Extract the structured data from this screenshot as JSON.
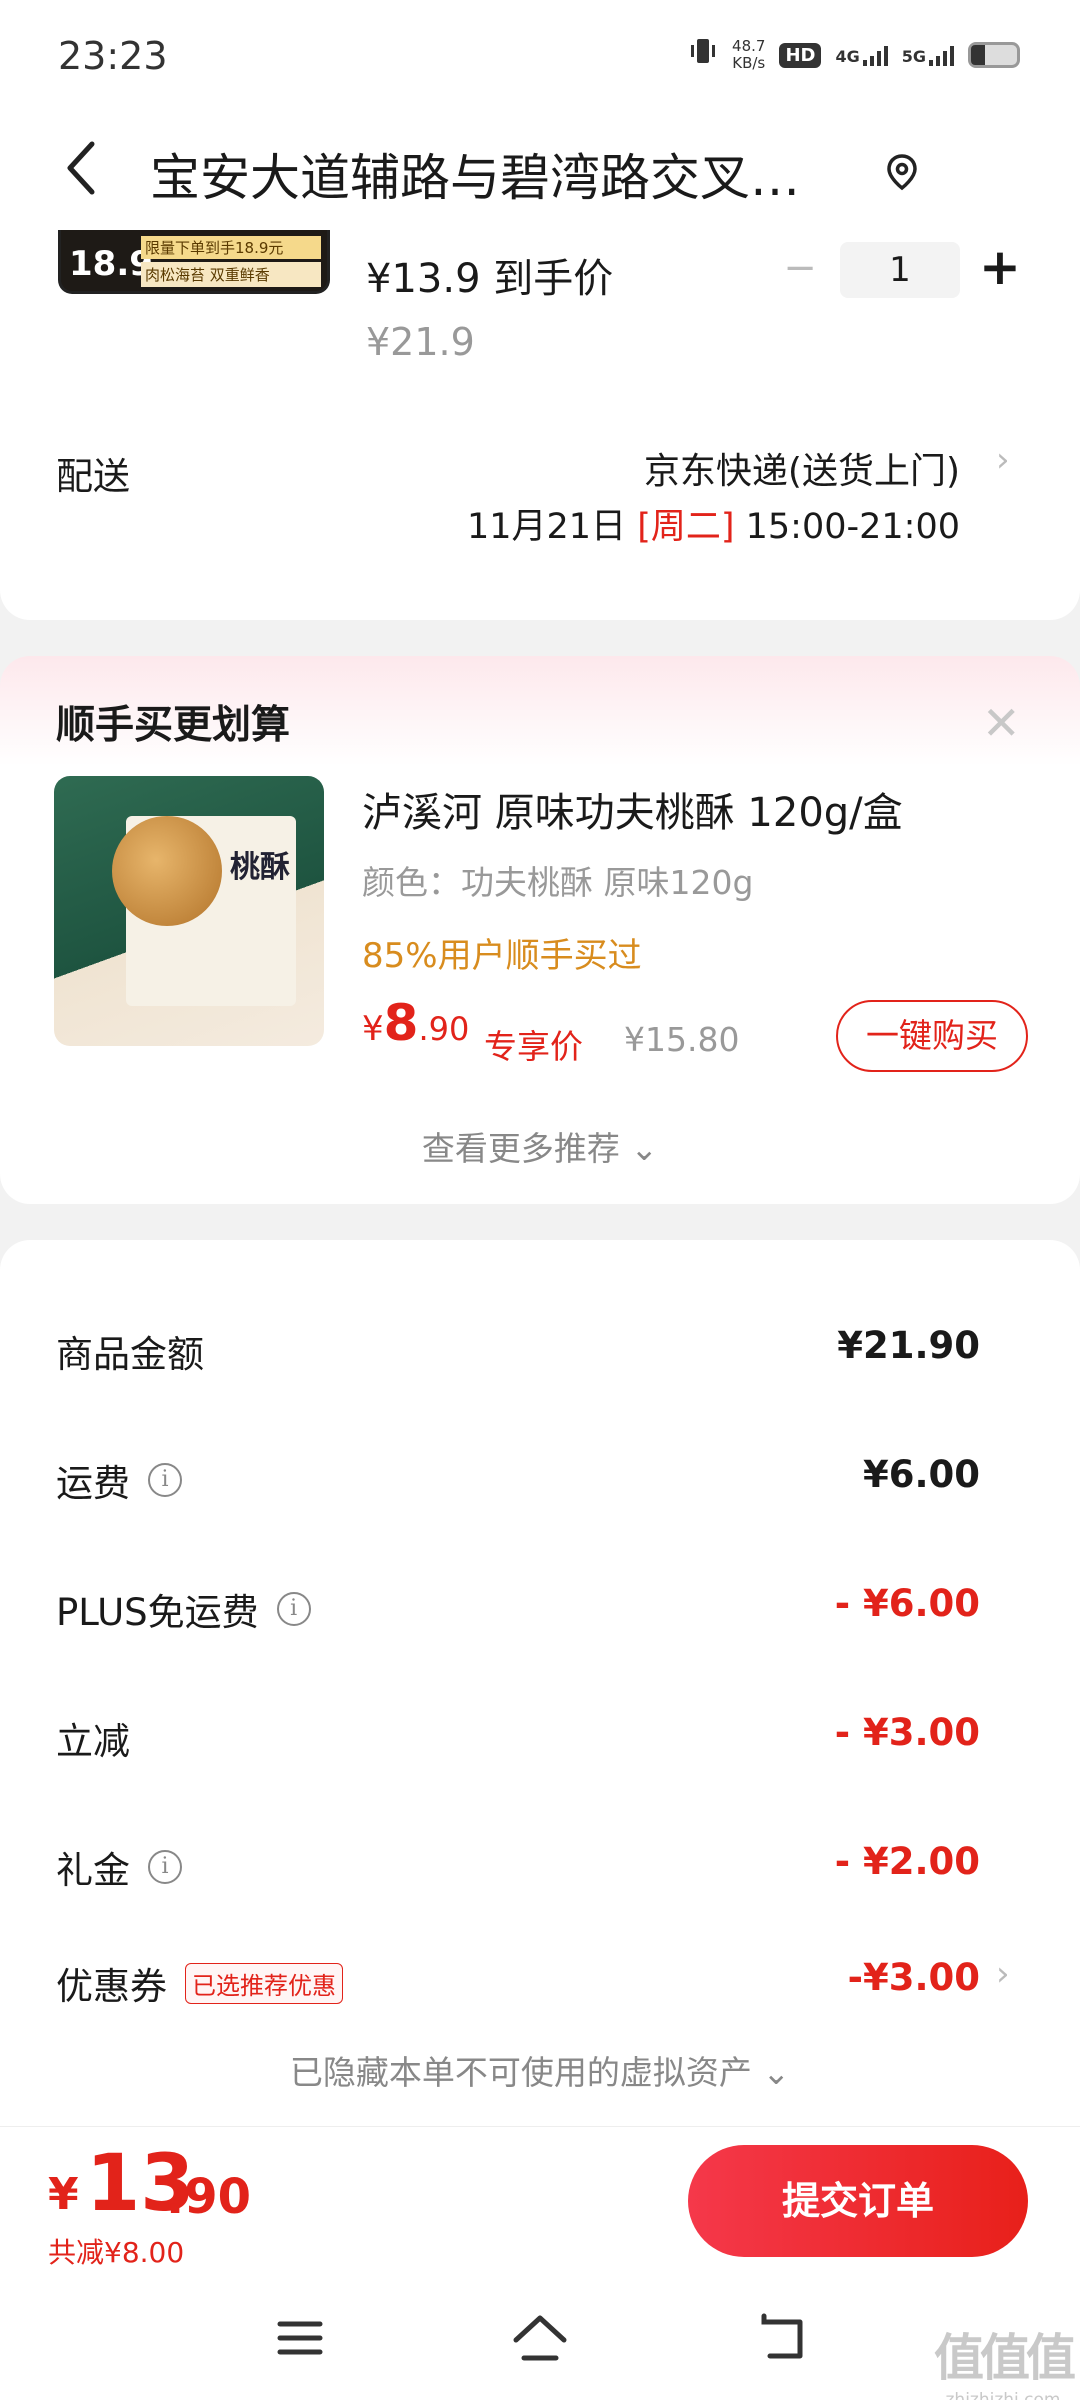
{
  "status_bar": {
    "time": "23:23",
    "speed": "48.7",
    "speed_unit": "KB/s",
    "hd": "HD",
    "net1": "4G",
    "net2": "5G"
  },
  "header": {
    "title": "宝安大道辅路与碧湾路交叉…"
  },
  "product": {
    "thumb_badge": "18.9",
    "thumb_text1": "限量下单到手18.9元",
    "thumb_text2": "肉松海苔 双重鲜香",
    "price": "¥13.9 到手价",
    "original_price": "¥21.9",
    "qty_minus": "−",
    "quantity": "1",
    "qty_plus": "+"
  },
  "delivery": {
    "label": "配送",
    "method": "京东快递(送货上门)",
    "date": "11月21日",
    "weekday": "[周二]",
    "slot": "15:00-21:00",
    "chevron": "›"
  },
  "recommend": {
    "title": "顺手买更划算",
    "close": "✕",
    "image_text": "桃酥",
    "name": "泸溪河 原味功夫桃酥 120g/盒",
    "spec": "颜色：功夫桃酥 原味120g",
    "bought": "85%用户顺手买过",
    "price_yen": "¥",
    "price_int": "8",
    "price_dec": ".90",
    "price_label": "专享价",
    "original_price": "¥15.80",
    "buy_button": "一键购买",
    "more": "查看更多推荐 ⌄"
  },
  "summary": {
    "rows": [
      {
        "label": "商品金额",
        "value": "¥21.90"
      },
      {
        "label": "运费",
        "info": "i",
        "value": "¥6.00"
      },
      {
        "label": "PLUS免运费",
        "info": "i",
        "value": "- ¥6.00"
      },
      {
        "label": "立减",
        "value": "- ¥3.00"
      },
      {
        "label": "礼金",
        "info": "i",
        "value": "- ¥2.00"
      },
      {
        "label": "优惠券",
        "tag": "已选推荐优惠",
        "value": "-¥3.00",
        "chevron": "›"
      }
    ],
    "hidden_assets": "已隐藏本单不可使用的虚拟资产 ⌄"
  },
  "bottom": {
    "yen": "¥",
    "total_int": "13",
    "total_dec": ".90",
    "saved": "共减¥8.00",
    "submit": "提交订单"
  },
  "watermark": {
    "big": "值值值",
    "small": "zhizhizhi.com"
  },
  "colors": {
    "accent": "#e2231a",
    "orange": "#d88c1e",
    "muted": "#999999"
  },
  "icons": [
    "back-arrow-icon",
    "location-pin-icon",
    "info-icon",
    "chevron-right-icon",
    "close-icon",
    "menu-icon",
    "home-icon",
    "back-nav-icon"
  ]
}
